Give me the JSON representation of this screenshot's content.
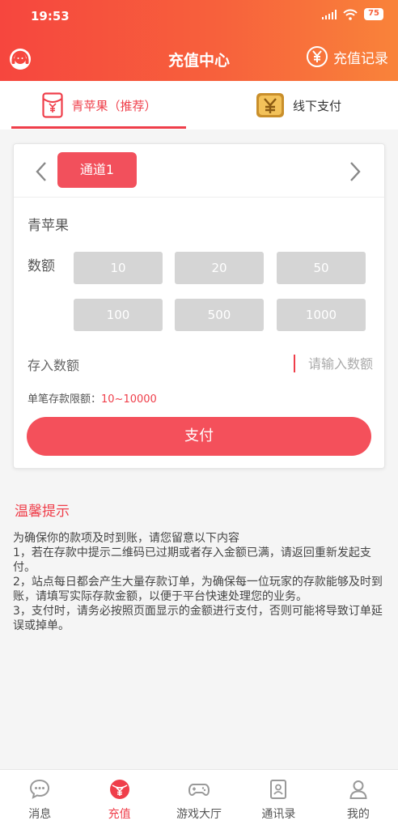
{
  "status_bar": {
    "time": "19:53",
    "battery": "75"
  },
  "header": {
    "title": "充值中心",
    "records_label": "充值记录"
  },
  "tabs": [
    {
      "label": "青苹果（推荐）",
      "active": true
    },
    {
      "label": "线下支付",
      "active": false
    }
  ],
  "card": {
    "channel_label": "通道1",
    "method_name": "青苹果",
    "amount_label": "数额",
    "amounts": [
      "10",
      "20",
      "50",
      "100",
      "500",
      "1000"
    ],
    "deposit_label": "存入数额",
    "deposit_placeholder": "请输入数额",
    "limit_label": "单笔存款限额：",
    "limit_value": "10~10000",
    "pay_label": "支付"
  },
  "tips": {
    "title": "温馨提示",
    "lines": [
      "为确保你的款项及时到账，请您留意以下内容",
      "1，若在存款中提示二维码已过期或者存入金额已满，请返回重新发起支付。",
      "2，站点每日都会产生大量存款订单，为确保每一位玩家的存款能够及时到账，请填写实际存款金额，以便于平台快速处理您的业务。",
      "3，支付时，请务必按照页面显示的金额进行支付，否则可能将导致订单延误或掉单。"
    ]
  },
  "tabbar": [
    {
      "label": "消息",
      "icon": "message-icon",
      "active": false
    },
    {
      "label": "充值",
      "icon": "recharge-icon",
      "active": true
    },
    {
      "label": "游戏大厅",
      "icon": "gamepad-icon",
      "active": false
    },
    {
      "label": "通讯录",
      "icon": "contacts-icon",
      "active": false
    },
    {
      "label": "我的",
      "icon": "user-icon",
      "active": false
    }
  ],
  "colors": {
    "accent": "#ef3e4a",
    "header_start": "#f6463e",
    "header_end": "#f9833a",
    "amount_bg": "#d5d5d5"
  }
}
